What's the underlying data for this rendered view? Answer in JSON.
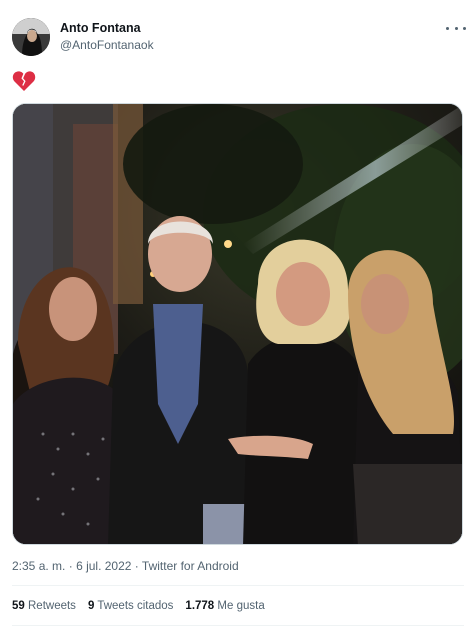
{
  "author": {
    "display_name": "Anto Fontana",
    "handle": "@AntoFontanaok"
  },
  "tweet": {
    "text_icon": "broken-heart-emoji",
    "media": {
      "type": "photo"
    }
  },
  "meta": {
    "time": "2:35 a. m.",
    "separator": "·",
    "date": "6 jul. 2022",
    "source": "Twitter for Android"
  },
  "stats": {
    "retweets_count": "59",
    "retweets_label": "Retweets",
    "quotes_count": "9",
    "quotes_label": "Tweets citados",
    "likes_count": "1.778",
    "likes_label": "Me gusta"
  },
  "colors": {
    "text_primary": "#0f1419",
    "text_secondary": "#536471",
    "heart": "#e0245e",
    "divider": "#eff3f4"
  },
  "icons": {
    "more": "more-horizontal-icon",
    "heart": "broken-heart-icon"
  }
}
